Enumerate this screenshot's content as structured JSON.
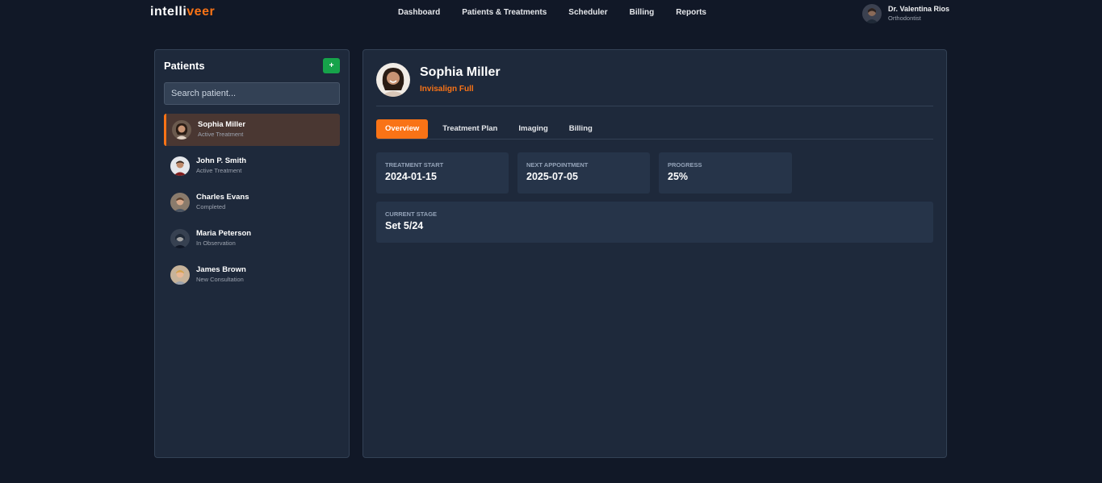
{
  "brand": {
    "prefix": "intelli",
    "accent": "veer",
    "accent_color": "#f97316"
  },
  "nav": {
    "items": [
      {
        "label": "Dashboard"
      },
      {
        "label": "Patients & Treatments"
      },
      {
        "label": "Scheduler"
      },
      {
        "label": "Billing"
      },
      {
        "label": "Reports"
      }
    ]
  },
  "user": {
    "name": "Dr. Valentina Rios",
    "role": "Orthodontist",
    "avatar_icon": "user-avatar"
  },
  "sidebar": {
    "title": "Patients",
    "add_label": "+",
    "add_color": "#16a34a",
    "search_placeholder": "Search patient...",
    "patients": [
      {
        "name": "Sophia Miller",
        "status": "Active Treatment",
        "active": true
      },
      {
        "name": "John P. Smith",
        "status": "Active Treatment",
        "active": false
      },
      {
        "name": "Charles Evans",
        "status": "Completed",
        "active": false
      },
      {
        "name": "Maria Peterson",
        "status": "In Observation",
        "active": false
      },
      {
        "name": "James Brown",
        "status": "New Consultation",
        "active": false
      }
    ]
  },
  "detail": {
    "name": "Sophia Miller",
    "plan": "Invisalign Full",
    "tabs": [
      {
        "label": "Overview",
        "active": true
      },
      {
        "label": "Treatment Plan",
        "active": false
      },
      {
        "label": "Imaging",
        "active": false
      },
      {
        "label": "Billing",
        "active": false
      }
    ],
    "cards": {
      "treatment_start": {
        "label": "TREATMENT START",
        "value": "2024-01-15"
      },
      "next_appointment": {
        "label": "NEXT APPOINTMENT",
        "value": "2025-07-05"
      },
      "progress": {
        "label": "PROGRESS",
        "value": "25%"
      },
      "current_stage": {
        "label": "CURRENT STAGE",
        "value": "Set 5/24"
      }
    }
  },
  "colors": {
    "background": "#111827",
    "panel": "#1e293b",
    "card": "#263449",
    "active_row": "#4a3732"
  }
}
